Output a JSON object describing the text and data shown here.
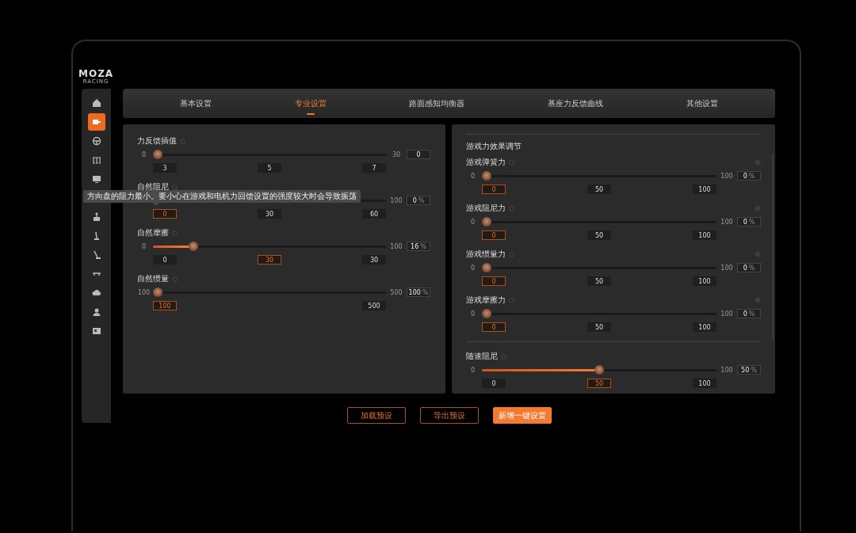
{
  "logo": {
    "brand": "MOZA",
    "tagline": "RACING"
  },
  "sidebar": {
    "items": [
      {
        "selected": false
      },
      {
        "selected": true
      },
      {
        "selected": false
      },
      {
        "selected": false
      },
      {
        "selected": false
      },
      {
        "selected": false
      },
      {
        "selected": false
      },
      {
        "selected": false
      },
      {
        "selected": false
      },
      {
        "selected": false
      },
      {
        "selected": false
      },
      {
        "selected": false
      }
    ]
  },
  "tabs": [
    {
      "label": "基本设置",
      "selected": false
    },
    {
      "label": "专业设置",
      "selected": true
    },
    {
      "label": "路面感知均衡器",
      "selected": false
    },
    {
      "label": "基座力反馈曲线",
      "selected": false
    },
    {
      "label": "其他设置",
      "selected": false
    }
  ],
  "left_panel": {
    "sliders": [
      {
        "label": "力反馈插值",
        "min": "0",
        "max": "30",
        "value": "0",
        "level": 0,
        "presets": [
          {
            "label": "3",
            "selected": false
          },
          {
            "label": "5",
            "selected": false
          },
          {
            "label": "7",
            "selected": false
          }
        ]
      },
      {
        "label": "自然阻尼",
        "max": "100",
        "value": "0",
        "unit": "%",
        "presets": [
          {
            "label": "0",
            "selected": true
          },
          {
            "label": "30",
            "selected": false
          },
          {
            "label": "60",
            "selected": false
          }
        ]
      },
      {
        "label": "自然摩擦",
        "min": "0",
        "max": "100",
        "value": "16",
        "unit": "%",
        "level": 0.16,
        "presets": [
          {
            "label": "0",
            "selected": false
          },
          {
            "label": "30",
            "selected": true
          },
          {
            "label": "30",
            "selected": false
          }
        ]
      },
      {
        "label": "自然惯量",
        "min": "100",
        "max": "500",
        "value": "100",
        "unit": "%",
        "level": 0,
        "presets": [
          {
            "label": "100",
            "selected": true
          },
          {
            "label": "500",
            "selected": false
          }
        ]
      }
    ]
  },
  "tooltip": {
    "text": "方向盘的阻力最小。要小心在游戏和电机力回馈设置的强度较大时会导致振荡"
  },
  "right_panel": {
    "section_title": "游戏力效果调节",
    "effects": [
      {
        "label": "游戏弹簧力",
        "min": "0",
        "max": "100",
        "value": "0",
        "unit": "%",
        "level": 0,
        "presets": [
          {
            "label": "0",
            "selected": true
          },
          {
            "label": "50",
            "selected": false
          },
          {
            "label": "100",
            "selected": false
          }
        ]
      },
      {
        "label": "游戏阻尼力",
        "min": "0",
        "max": "100",
        "value": "0",
        "unit": "%",
        "level": 0,
        "presets": [
          {
            "label": "0",
            "selected": true
          },
          {
            "label": "50",
            "selected": false
          },
          {
            "label": "100",
            "selected": false
          }
        ]
      },
      {
        "label": "游戏惯量力",
        "min": "0",
        "max": "100",
        "value": "0",
        "unit": "%",
        "level": 0,
        "presets": [
          {
            "label": "0",
            "selected": true
          },
          {
            "label": "50",
            "selected": false
          },
          {
            "label": "100",
            "selected": false
          }
        ]
      },
      {
        "label": "游戏摩擦力",
        "min": "0",
        "max": "100",
        "value": "0",
        "unit": "%",
        "level": 0,
        "presets": [
          {
            "label": "0",
            "selected": true
          },
          {
            "label": "50",
            "selected": false
          },
          {
            "label": "100",
            "selected": false
          }
        ]
      }
    ],
    "speed_damping": {
      "label": "随速阻尼",
      "min": "0",
      "max": "100",
      "value": "50",
      "unit": "%",
      "level": 0.5,
      "presets": [
        {
          "label": "0",
          "selected": false
        },
        {
          "label": "50",
          "selected": true
        },
        {
          "label": "100",
          "selected": false
        }
      ]
    }
  },
  "buttons": [
    {
      "label": "加载预设",
      "kind": "outline"
    },
    {
      "label": "导出预设",
      "kind": "outline"
    },
    {
      "label": "新增一键设置",
      "kind": "primary"
    }
  ]
}
